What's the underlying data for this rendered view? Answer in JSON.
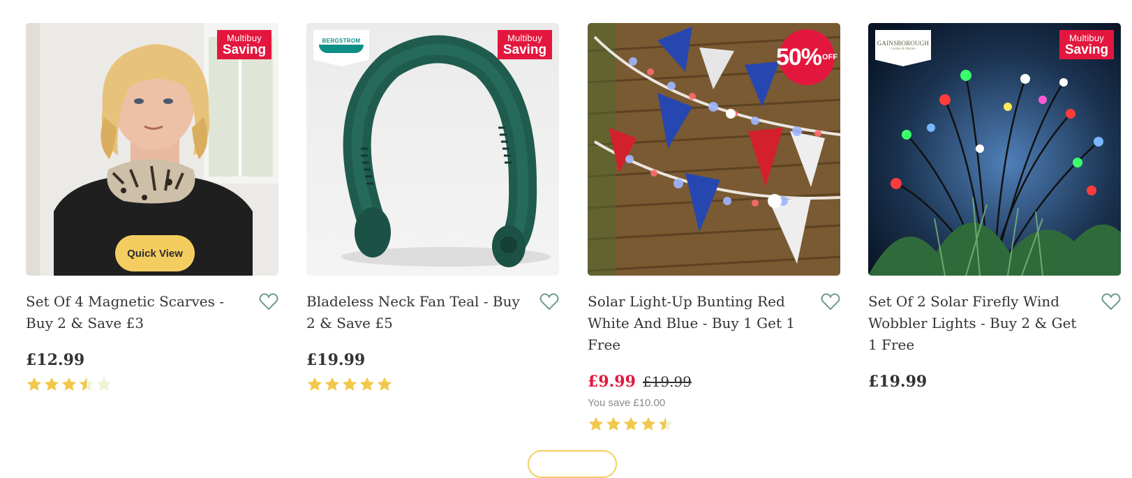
{
  "products": [
    {
      "title": "Set Of 4 Magnetic Scarves - Buy 2 & Save £3",
      "price": "£12.99",
      "was_price": "",
      "you_save": "",
      "rating": 3.5,
      "badge": {
        "line1": "Multibuy",
        "line2": "Saving"
      },
      "quick_view_label": "Quick View"
    },
    {
      "title": "Bladeless Neck Fan Teal - Buy 2 & Save £5",
      "price": "£19.99",
      "was_price": "",
      "you_save": "",
      "rating": 5,
      "brand": "BERGSTROM",
      "badge": {
        "line1": "Multibuy",
        "line2": "Saving"
      }
    },
    {
      "title": "Solar Light-Up Bunting Red White And Blue - Buy 1 Get 1 Free",
      "price": "£9.99",
      "was_price": "£19.99",
      "you_save": "You save £10.00",
      "rating": 4.5,
      "discount_badge": {
        "percent": "50%",
        "label": "OFF"
      }
    },
    {
      "title": "Set Of 2 Solar Firefly Wind Wobbler Lights - Buy 2 & Get 1 Free",
      "price": "£19.99",
      "was_price": "",
      "you_save": "",
      "rating": null,
      "brand": "GAINSBOROUGH",
      "brand_sub": "Garden & Mobile",
      "badge": {
        "line1": "Multibuy",
        "line2": "Saving"
      }
    }
  ],
  "colors": {
    "accent_red": "#e3173e",
    "star_gold": "#f2c84b",
    "star_empty": "#eef3d4",
    "quick_view_bg": "#f4cd61",
    "heart_outline": "#6e9a88"
  },
  "icons": {
    "wishlist": "heart-outline-icon",
    "rating": "star-icon"
  }
}
